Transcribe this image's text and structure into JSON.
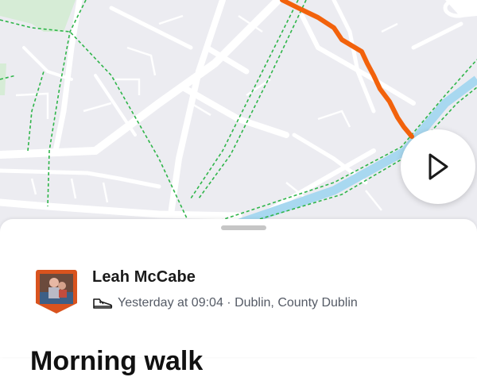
{
  "activity": {
    "athlete_name": "Leah McCabe",
    "sport_icon": "shoe-icon",
    "meta": "Yesterday at 09:04 · Dublin, County Dublin",
    "title": "Morning walk"
  },
  "map": {
    "route_color": "#f2620c",
    "canal_color": "#a8d8f0",
    "trail_color": "#2fb54a"
  },
  "controls": {
    "play_icon": "play-icon"
  }
}
